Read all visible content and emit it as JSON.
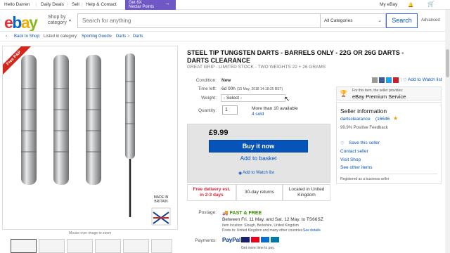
{
  "topbar": {
    "greeting": "Hello Darren",
    "daily_deals": "Daily Deals",
    "sell": "Sell",
    "help": "Help & Contact",
    "promo_line1": "Get 6X",
    "promo_line2": "Nectar Points",
    "my_ebay": "My eBay"
  },
  "header": {
    "logo_e": "e",
    "logo_b": "b",
    "logo_a": "a",
    "logo_y": "y",
    "shop_by_1": "Shop by",
    "shop_by_2": "category",
    "search_placeholder": "Search for anything",
    "category": "All Categories",
    "search_button": "Search",
    "advanced": "Advanced"
  },
  "breadcrumb": {
    "back": "Back to Shop",
    "listed_in": "Listed in category:",
    "items": [
      "Sporting Goods",
      "Darts",
      "Darts"
    ]
  },
  "image": {
    "ribbon": "Free P&P",
    "made_in": "MADE IN BRITAIN",
    "mouseover": "Mouse over image to zoom"
  },
  "listing": {
    "title": "STEEL TIP TUNGSTEN DARTS - BARRELS ONLY - 22G OR 26G DARTS - DARTS CLEARANCE",
    "subtitle": "GREAT GRIP - LIMITED STOCK - TWO WEIGHTS 22 + 26 GRAMS",
    "add_watch": "Add to Watch list",
    "condition_label": "Condition:",
    "condition": "New",
    "time_left_label": "Time left:",
    "time_left": "6d 00h",
    "time_left_detail": "(15 May, 2018   14:18:25 BST)",
    "weight_label": "Weight:",
    "weight_select": "- Select -",
    "quantity_label": "Quantity:",
    "quantity": "1",
    "available": "More than 10 available",
    "sold": "4 sold",
    "price": "£9.99",
    "buy_now": "Buy it now",
    "add_basket": "Add to basket",
    "add_watch_list": "Add to Watch list",
    "free_delivery_1": "Free delivery est.",
    "free_delivery_2": "in 2-3 days",
    "returns": "30-day returns",
    "located_1": "Located in United",
    "located_2": "Kingdom"
  },
  "postage": {
    "label": "Postage:",
    "fast_free": "FAST & FREE",
    "between": "Between Fri. 11 May. and Sat. 12 May. to TS66SZ",
    "location": "Item location:  Slough, Berkshire, United Kingdom",
    "posts_to": "Posts to: United Kingdom and many other countries",
    "see_details": "See details",
    "payments_label": "Payments:",
    "paypal": "PayPal",
    "credit": "Get more time to pay."
  },
  "seller": {
    "provided_by": "For this item, the seller provides:",
    "premium": "eBay Premium Service",
    "heading": "Seller information",
    "name": "dartsclearance",
    "feedback_count": "(16646",
    "positive": "99.9% Positive Feedback",
    "save": "Save this seller",
    "contact": "Contact seller",
    "visit_shop": "Visit Shop",
    "see_other": "See other items",
    "registered": "Registered as a business seller"
  },
  "colors": {
    "buy_button": "#0654ba",
    "link": "#0654ba",
    "free_delivery": "#dd1e31",
    "promo": "#6f57c6"
  }
}
